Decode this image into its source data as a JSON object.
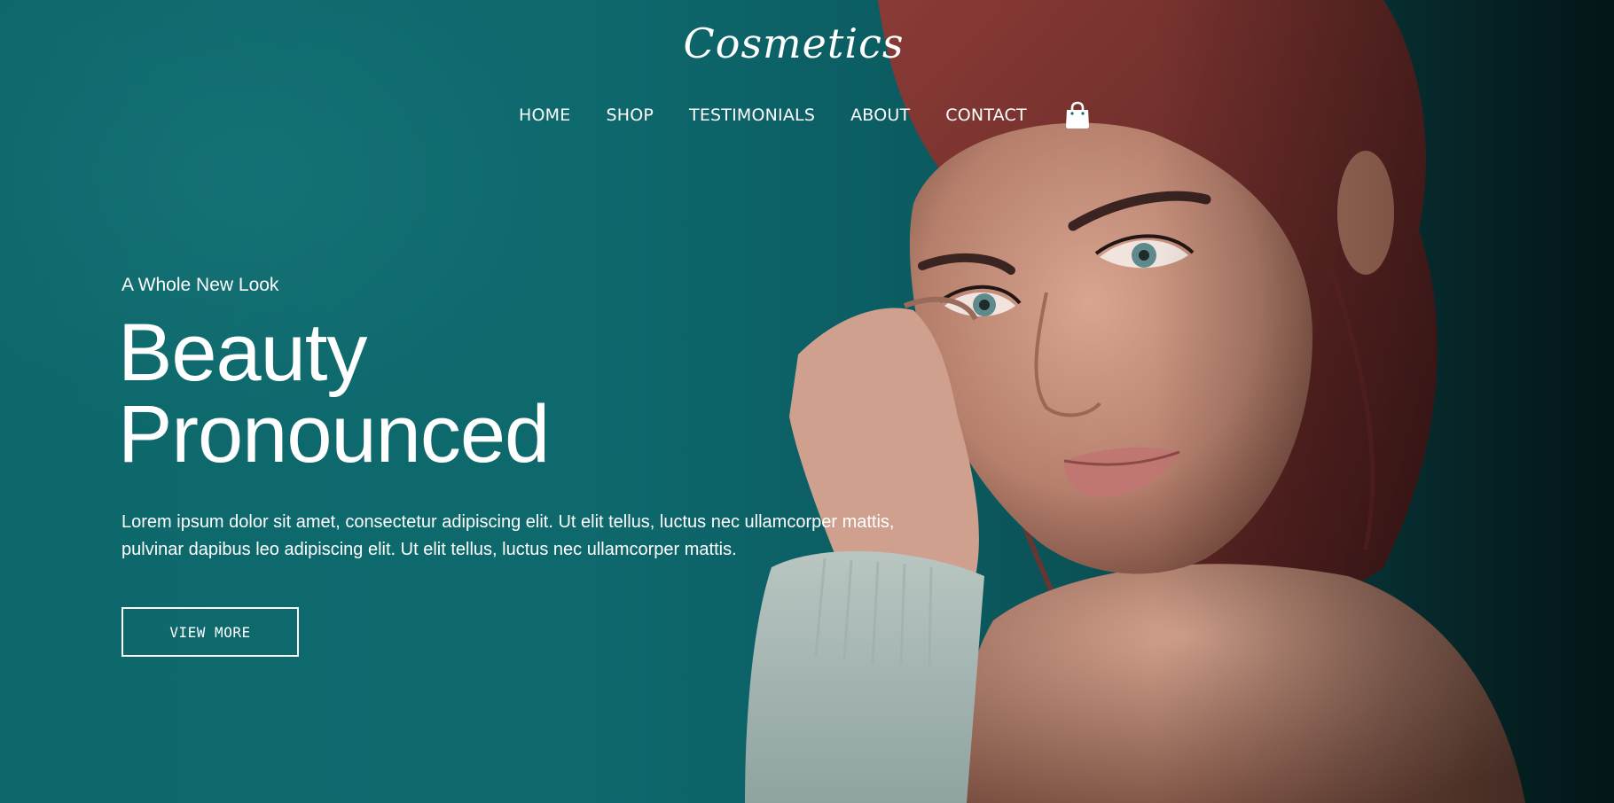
{
  "brand": {
    "logo": "Cosmetics"
  },
  "nav": {
    "items": [
      {
        "label": "HOME"
      },
      {
        "label": "SHOP"
      },
      {
        "label": "TESTIMONIALS"
      },
      {
        "label": "ABOUT"
      },
      {
        "label": "CONTACT"
      }
    ],
    "cart_icon": "shopping-bag-icon"
  },
  "hero": {
    "eyebrow": "A Whole New Look",
    "headline_line1": "Beauty",
    "headline_line2": "Pronounced",
    "body": "Lorem ipsum dolor sit amet, consectetur adipiscing elit. Ut elit tellus, luctus nec ullamcorper mattis, pulvinar dapibus leo adipiscing elit. Ut elit tellus, luctus nec ullamcorper mattis.",
    "cta_label": "VIEW MORE"
  },
  "colors": {
    "background_teal": "#0e6a6e",
    "text": "#ffffff"
  }
}
